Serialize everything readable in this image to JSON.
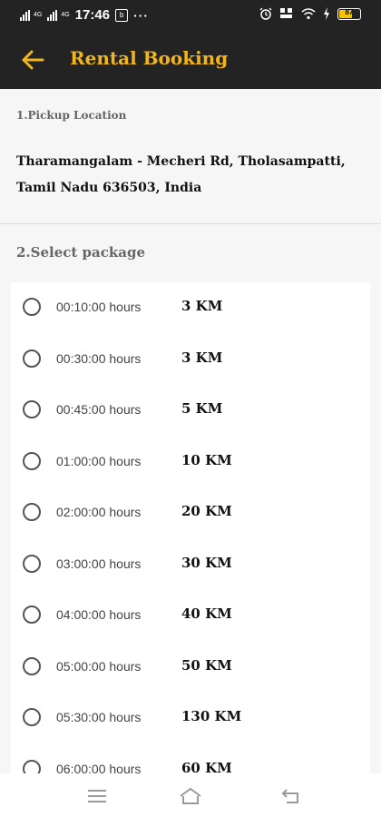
{
  "status_bar": {
    "network_left": "4G",
    "network_right": "4G",
    "time": "17:46",
    "notification_glyph": "b",
    "more": "···",
    "battery_level": "87",
    "icons": [
      "signal-icon",
      "alarm-icon",
      "volte-icon",
      "wifi-icon",
      "charging-icon",
      "battery-icon"
    ]
  },
  "app_bar": {
    "title": "Rental Booking",
    "back_icon": "arrow-left-icon",
    "accent_color": "#f2b51c",
    "background_color": "#232323"
  },
  "pickup": {
    "section_label": "1.Pickup Location",
    "address": "Tharamangalam - Mecheri Rd, Tholasampatti, Tamil Nadu 636503, India"
  },
  "package": {
    "section_label": "2.Select package",
    "items": [
      {
        "hours": "00:10:00 hours",
        "km": "3 KM",
        "selected": false
      },
      {
        "hours": "00:30:00 hours",
        "km": "3 KM",
        "selected": false
      },
      {
        "hours": "00:45:00 hours",
        "km": "5 KM",
        "selected": false
      },
      {
        "hours": "01:00:00 hours",
        "km": "10 KM",
        "selected": false
      },
      {
        "hours": "02:00:00 hours",
        "km": "20 KM",
        "selected": false
      },
      {
        "hours": "03:00:00 hours",
        "km": "30 KM",
        "selected": false
      },
      {
        "hours": "04:00:00 hours",
        "km": "40 KM",
        "selected": false
      },
      {
        "hours": "05:00:00 hours",
        "km": "50 KM",
        "selected": false
      },
      {
        "hours": "05:30:00 hours",
        "km": "130 KM",
        "selected": false
      },
      {
        "hours": "06:00:00 hours",
        "km": "60 KM",
        "selected": false
      }
    ]
  },
  "nav_bar": {
    "icons": [
      "menu-icon",
      "home-icon",
      "back-nav-icon"
    ]
  }
}
